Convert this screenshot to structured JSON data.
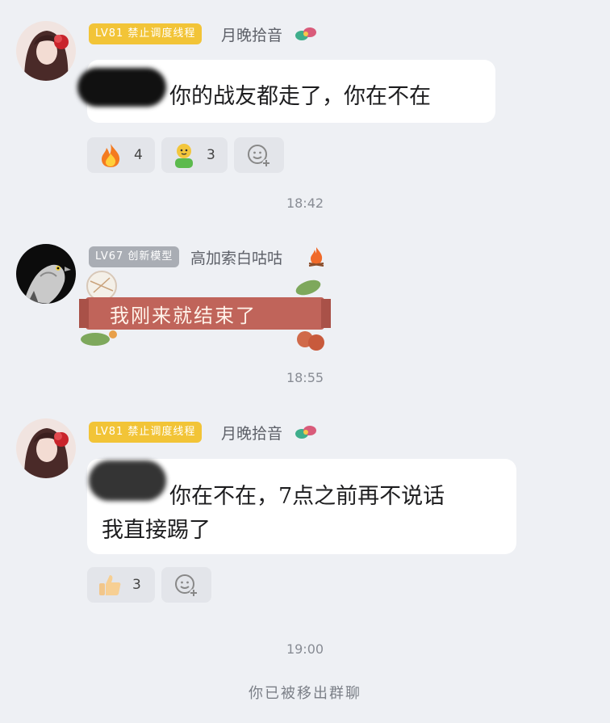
{
  "messages": [
    {
      "badge": "LV81 禁止调度线程",
      "nickname": "月晚拾音",
      "text": "你的战友都走了，你在不在",
      "reactions": [
        {
          "icon": "fire-emoji",
          "count": "4"
        },
        {
          "icon": "person-emoji",
          "count": "3"
        }
      ],
      "time": "18:42"
    },
    {
      "badge": "LV67 创新模型",
      "nickname": "高加索白咕咕",
      "sticker_text": "我刚来就结束了",
      "time": "18:55"
    },
    {
      "badge": "LV81 禁止调度线程",
      "nickname": "月晚拾音",
      "text_line1": "你在不在，7点之前再不说话",
      "text_line2": "我直接踢了",
      "reactions": [
        {
          "icon": "thumbs-up-emoji",
          "count": "3"
        }
      ],
      "time": "19:00"
    }
  ],
  "system_notice": "你已被移出群聊",
  "colors": {
    "background": "#eef0f4",
    "gold_badge": "#f2c437",
    "gray_badge": "#a9adb4",
    "bubble": "#ffffff"
  }
}
